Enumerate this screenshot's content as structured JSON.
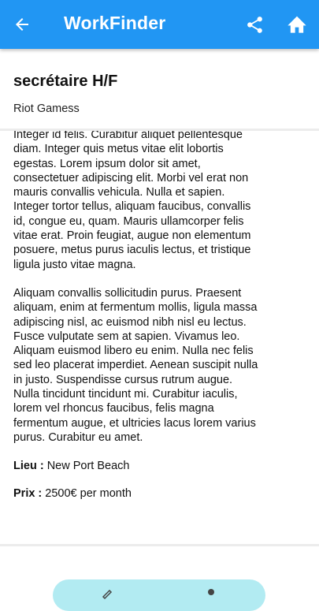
{
  "appbar": {
    "title": "WorkFinder",
    "back_icon": "arrow-back-icon",
    "share_icon": "share-icon",
    "home_icon": "home-icon",
    "color": "#2196f3"
  },
  "job": {
    "title": "secrétaire H/F",
    "company": "Riot Gamess",
    "description": [
      "Integer id felis. Curabitur aliquet pellentesque diam. Integer quis metus vitae elit lobortis egestas. Lorem ipsum dolor sit amet, consectetuer adipiscing elit. Morbi vel erat non mauris convallis vehicula. Nulla et sapien. Integer tortor tellus, aliquam faucibus, convallis id, congue eu, quam. Mauris ullamcorper felis vitae erat. Proin feugiat, augue non elementum posuere, metus purus iaculis lectus, et tristique ligula justo vitae magna.",
      "Aliquam convallis sollicitudin purus. Praesent aliquam, enim at fermentum mollis, ligula massa adipiscing nisl, ac euismod nibh nisl eu lectus. Fusce vulputate sem at sapien. Vivamus leo. Aliquam euismod libero eu enim. Nulla nec felis sed leo placerat imperdiet. Aenean suscipit nulla in justo. Suspendisse cursus rutrum augue. Nulla tincidunt tincidunt mi. Curabitur iaculis, lorem vel rhoncus faucibus, felis magna fermentum augue, et ultricies lacus lorem varius purus. Curabitur eu amet."
    ],
    "location_label": "Lieu :",
    "location_value": "New Port Beach",
    "price_label": "Prix :",
    "price_value": "2500€ per month"
  },
  "bottom_bar": {
    "color": "#b2ebf2"
  }
}
